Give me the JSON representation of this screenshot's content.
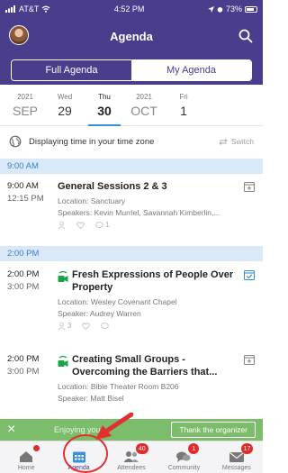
{
  "status": {
    "carrier": "AT&T",
    "time": "4:52 PM",
    "battery": "73%"
  },
  "header": {
    "title": "Agenda"
  },
  "segments": {
    "full": "Full Agenda",
    "mine": "My Agenda"
  },
  "dates": [
    {
      "top": "2021",
      "bottom": "SEP"
    },
    {
      "top": "Wed",
      "bottom": "29"
    },
    {
      "top": "Thu",
      "bottom": "30"
    },
    {
      "top": "2021",
      "bottom": "OCT"
    },
    {
      "top": "Fri",
      "bottom": "1"
    }
  ],
  "timezone": {
    "text": "Displaying time in your time zone",
    "switch": "Switch"
  },
  "groups": [
    {
      "header": "9:00 AM"
    },
    {
      "header": "2:00 PM"
    }
  ],
  "sessions": [
    {
      "start": "9:00 AM",
      "end": "12:15 PM",
      "title": "General Sessions 2 & 3",
      "location": "Location: Sanctuary",
      "speakers": "Speakers: Kevin Murriel, Savannah Kimberlin,...",
      "comments": "1"
    },
    {
      "start": "2:00 PM",
      "end": "3:00 PM",
      "title": "Fresh Expressions of People Over Property",
      "location": "Location: Wesley Covenant Chapel",
      "speakers": "Speaker: Audrey Warren",
      "attendees": "3"
    },
    {
      "start": "2:00 PM",
      "end": "3:00 PM",
      "title": "Creating Small Groups - Overcoming the Barriers that...",
      "location": "Location: Bible Theater Room B206",
      "speakers": "Speaker: Matt Bisel"
    }
  ],
  "banner": {
    "text": "Enjoying your...",
    "button": "Thank the organizer"
  },
  "tabs": [
    {
      "label": "Home"
    },
    {
      "label": "Agenda"
    },
    {
      "label": "Attendees",
      "badge": "40"
    },
    {
      "label": "Community",
      "badge": "1"
    },
    {
      "label": "Messages",
      "badge": "17"
    }
  ],
  "colors": {
    "brand": "#4a3d8c",
    "accent": "#3b8fd8",
    "video": "#1aa34a",
    "banner": "#7bbd6a",
    "badge": "#e02b2b"
  }
}
